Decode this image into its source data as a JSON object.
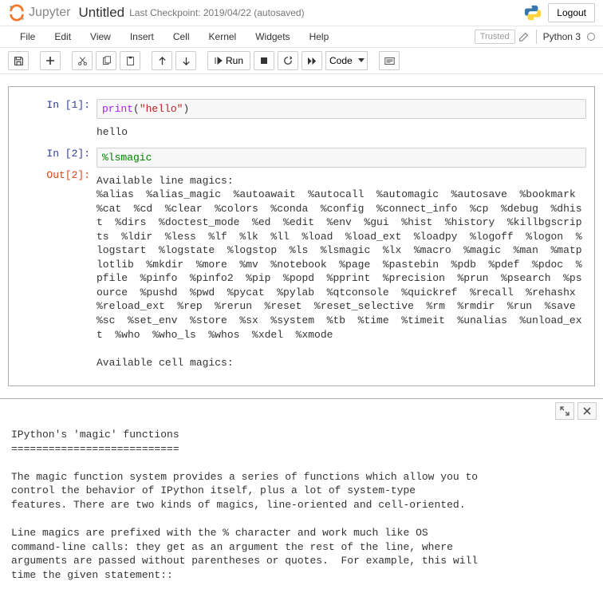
{
  "header": {
    "logo_text": "Jupyter",
    "title": "Untitled",
    "checkpoint": "Last Checkpoint: 2019/04/22  (autosaved)",
    "logout": "Logout"
  },
  "menu": {
    "file": "File",
    "edit": "Edit",
    "view": "View",
    "insert": "Insert",
    "cell": "Cell",
    "kernel": "Kernel",
    "widgets": "Widgets",
    "help": "Help",
    "trusted": "Trusted",
    "kernel_name": "Python 3"
  },
  "toolbar": {
    "run": "Run",
    "celltype": "Code"
  },
  "cells": {
    "c1": {
      "prompt": "In [1]:",
      "code_builtin": "print",
      "code_open": "(",
      "code_str": "\"hello\"",
      "code_close": ")",
      "output": "hello"
    },
    "c2": {
      "prompt": "In [2]:",
      "code": "%lsmagic",
      "out_prompt": "Out[2]:",
      "output": "Available line magics:\n%alias  %alias_magic  %autoawait  %autocall  %automagic  %autosave  %bookmark  %cat  %cd  %clear  %colors  %conda  %config  %connect_info  %cp  %debug  %dhist  %dirs  %doctest_mode  %ed  %edit  %env  %gui  %hist  %history  %killbgscripts  %ldir  %less  %lf  %lk  %ll  %load  %load_ext  %loadpy  %logoff  %logon  %logstart  %logstate  %logstop  %ls  %lsmagic  %lx  %macro  %magic  %man  %matplotlib  %mkdir  %more  %mv  %notebook  %page  %pastebin  %pdb  %pdef  %pdoc  %pfile  %pinfo  %pinfo2  %pip  %popd  %pprint  %precision  %prun  %psearch  %psource  %pushd  %pwd  %pycat  %pylab  %qtconsole  %quickref  %recall  %rehashx  %reload_ext  %rep  %rerun  %reset  %reset_selective  %rm  %rmdir  %run  %save  %sc  %set_env  %store  %sx  %system  %tb  %time  %timeit  %unalias  %unload_ext  %who  %who_ls  %whos  %xdel  %xmode\n\nAvailable cell magics:"
    }
  },
  "help": {
    "body": "IPython's 'magic' functions\n===========================\n\nThe magic function system provides a series of functions which allow you to\ncontrol the behavior of IPython itself, plus a lot of system-type\nfeatures. There are two kinds of magics, line-oriented and cell-oriented.\n\nLine magics are prefixed with the % character and work much like OS\ncommand-line calls: they get as an argument the rest of the line, where\narguments are passed without parentheses or quotes.  For example, this will\ntime the given statement::"
  }
}
